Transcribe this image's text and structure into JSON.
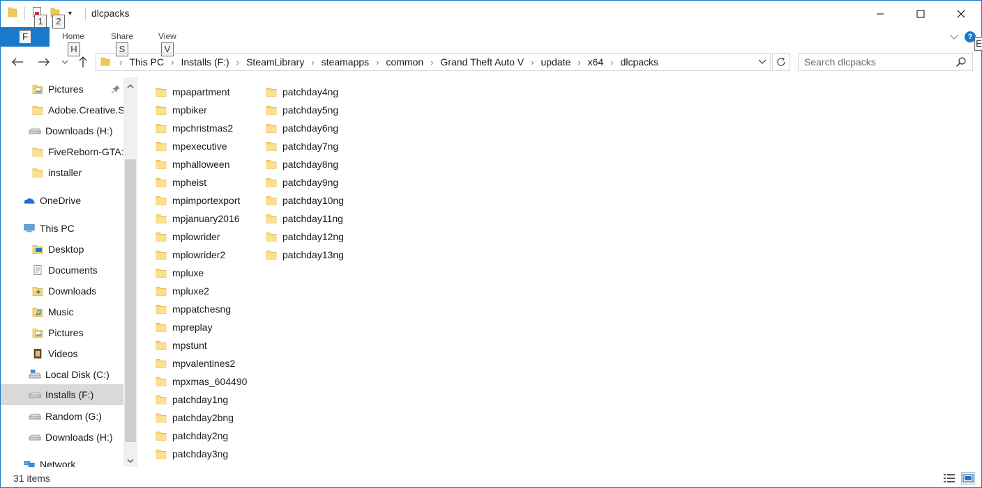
{
  "window": {
    "title": "dlcpacks"
  },
  "quick_access": {
    "keytip_1": "1",
    "keytip_2": "2"
  },
  "ribbon": {
    "file_label": "F",
    "tabs": [
      {
        "label": "Home",
        "keytip": "H"
      },
      {
        "label": "Share",
        "keytip": "S"
      },
      {
        "label": "View",
        "keytip": "V"
      }
    ],
    "help_label": "?",
    "help_keytip": "E"
  },
  "address": {
    "breadcrumbs": [
      "This PC",
      "Installs (F:)",
      "SteamLibrary",
      "steamapps",
      "common",
      "Grand Theft Auto V",
      "update",
      "x64",
      "dlcpacks"
    ]
  },
  "search": {
    "placeholder": "Search dlcpacks"
  },
  "sidebar": {
    "items": [
      {
        "label": "Pictures",
        "icon": "pictures-folder-icon",
        "pinned": true
      },
      {
        "label": "Adobe.Creative.S",
        "icon": "folder-icon"
      },
      {
        "label": "Downloads (H:)",
        "icon": "drive-icon"
      },
      {
        "label": "FiveReborn-GTA:",
        "icon": "folder-icon"
      },
      {
        "label": "installer",
        "icon": "folder-icon"
      },
      {
        "label": "OneDrive",
        "icon": "onedrive-icon"
      },
      {
        "label": "This PC",
        "icon": "computer-icon"
      },
      {
        "label": "Desktop",
        "icon": "desktop-folder-icon"
      },
      {
        "label": "Documents",
        "icon": "documents-folder-icon"
      },
      {
        "label": "Downloads",
        "icon": "downloads-folder-icon"
      },
      {
        "label": "Music",
        "icon": "music-folder-icon"
      },
      {
        "label": "Pictures",
        "icon": "pictures-folder-icon"
      },
      {
        "label": "Videos",
        "icon": "videos-folder-icon"
      },
      {
        "label": "Local Disk (C:)",
        "icon": "windows-drive-icon"
      },
      {
        "label": "Installs (F:)",
        "icon": "drive-icon",
        "selected": true
      },
      {
        "label": "Random (G:)",
        "icon": "drive-icon"
      },
      {
        "label": "Downloads (H:)",
        "icon": "drive-icon"
      },
      {
        "label": "Network",
        "icon": "network-icon"
      }
    ]
  },
  "files": {
    "column1": [
      "mpapartment",
      "mpbiker",
      "mpchristmas2",
      "mpexecutive",
      "mphalloween",
      "mpheist",
      "mpimportexport",
      "mpjanuary2016",
      "mplowrider",
      "mplowrider2",
      "mpluxe",
      "mpluxe2",
      "mppatchesng",
      "mpreplay",
      "mpstunt",
      "mpvalentines2",
      "mpxmas_604490",
      "patchday1ng",
      "patchday2bng",
      "patchday2ng",
      "patchday3ng"
    ],
    "column2": [
      "patchday4ng",
      "patchday5ng",
      "patchday6ng",
      "patchday7ng",
      "patchday8ng",
      "patchday9ng",
      "patchday10ng",
      "patchday11ng",
      "patchday12ng",
      "patchday13ng"
    ]
  },
  "status": {
    "item_count": "31 items"
  },
  "colors": {
    "accent": "#1979ca",
    "folder": "#f8d775",
    "selected_bg": "#d9d9d9"
  }
}
